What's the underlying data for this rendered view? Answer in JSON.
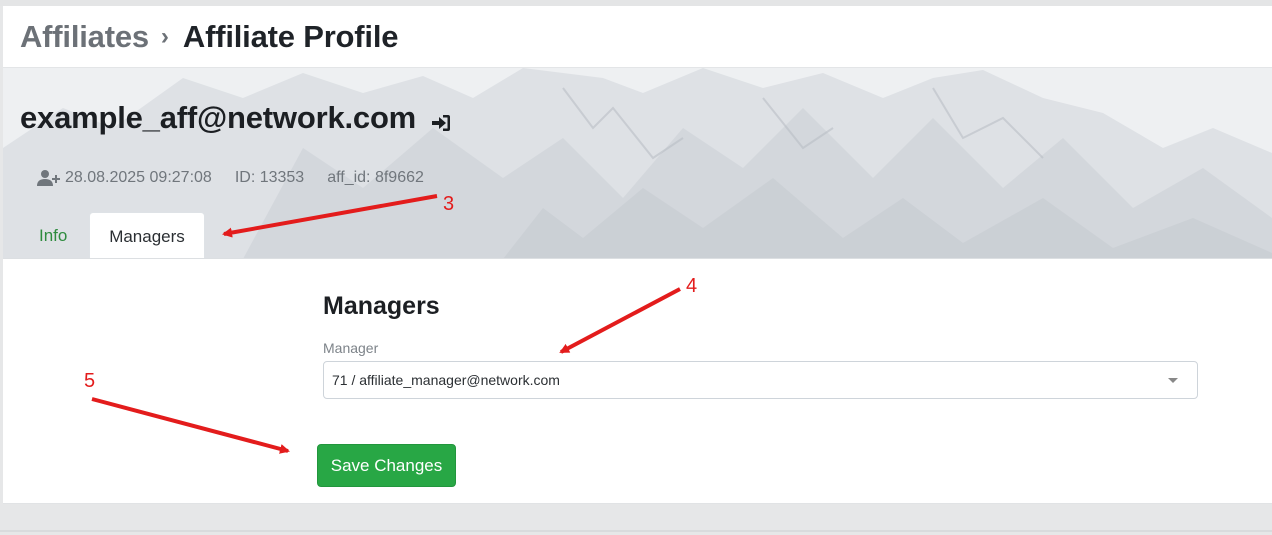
{
  "breadcrumb": {
    "parent": "Affiliates",
    "separator": "›",
    "current": "Affiliate Profile"
  },
  "profile": {
    "email": "example_aff@network.com",
    "signin_icon": "sign-in-icon",
    "created_icon": "user-plus-icon",
    "created_at": "28.08.2025 09:27:08",
    "id_text": "ID: 13353",
    "aff_id_text": "aff_id: 8f9662"
  },
  "tabs": [
    {
      "label": "Info",
      "active": false
    },
    {
      "label": "Managers",
      "active": true
    }
  ],
  "managers_section": {
    "title": "Managers",
    "field_label": "Manager",
    "selected_value": "71 / affiliate_manager@network.com",
    "save_label": "Save Changes"
  },
  "annotations": [
    "3",
    "4",
    "5"
  ],
  "colors": {
    "accent_green": "#28a745",
    "tab_link_green": "#2e8b3e",
    "annotation_red": "#e31c1c"
  }
}
